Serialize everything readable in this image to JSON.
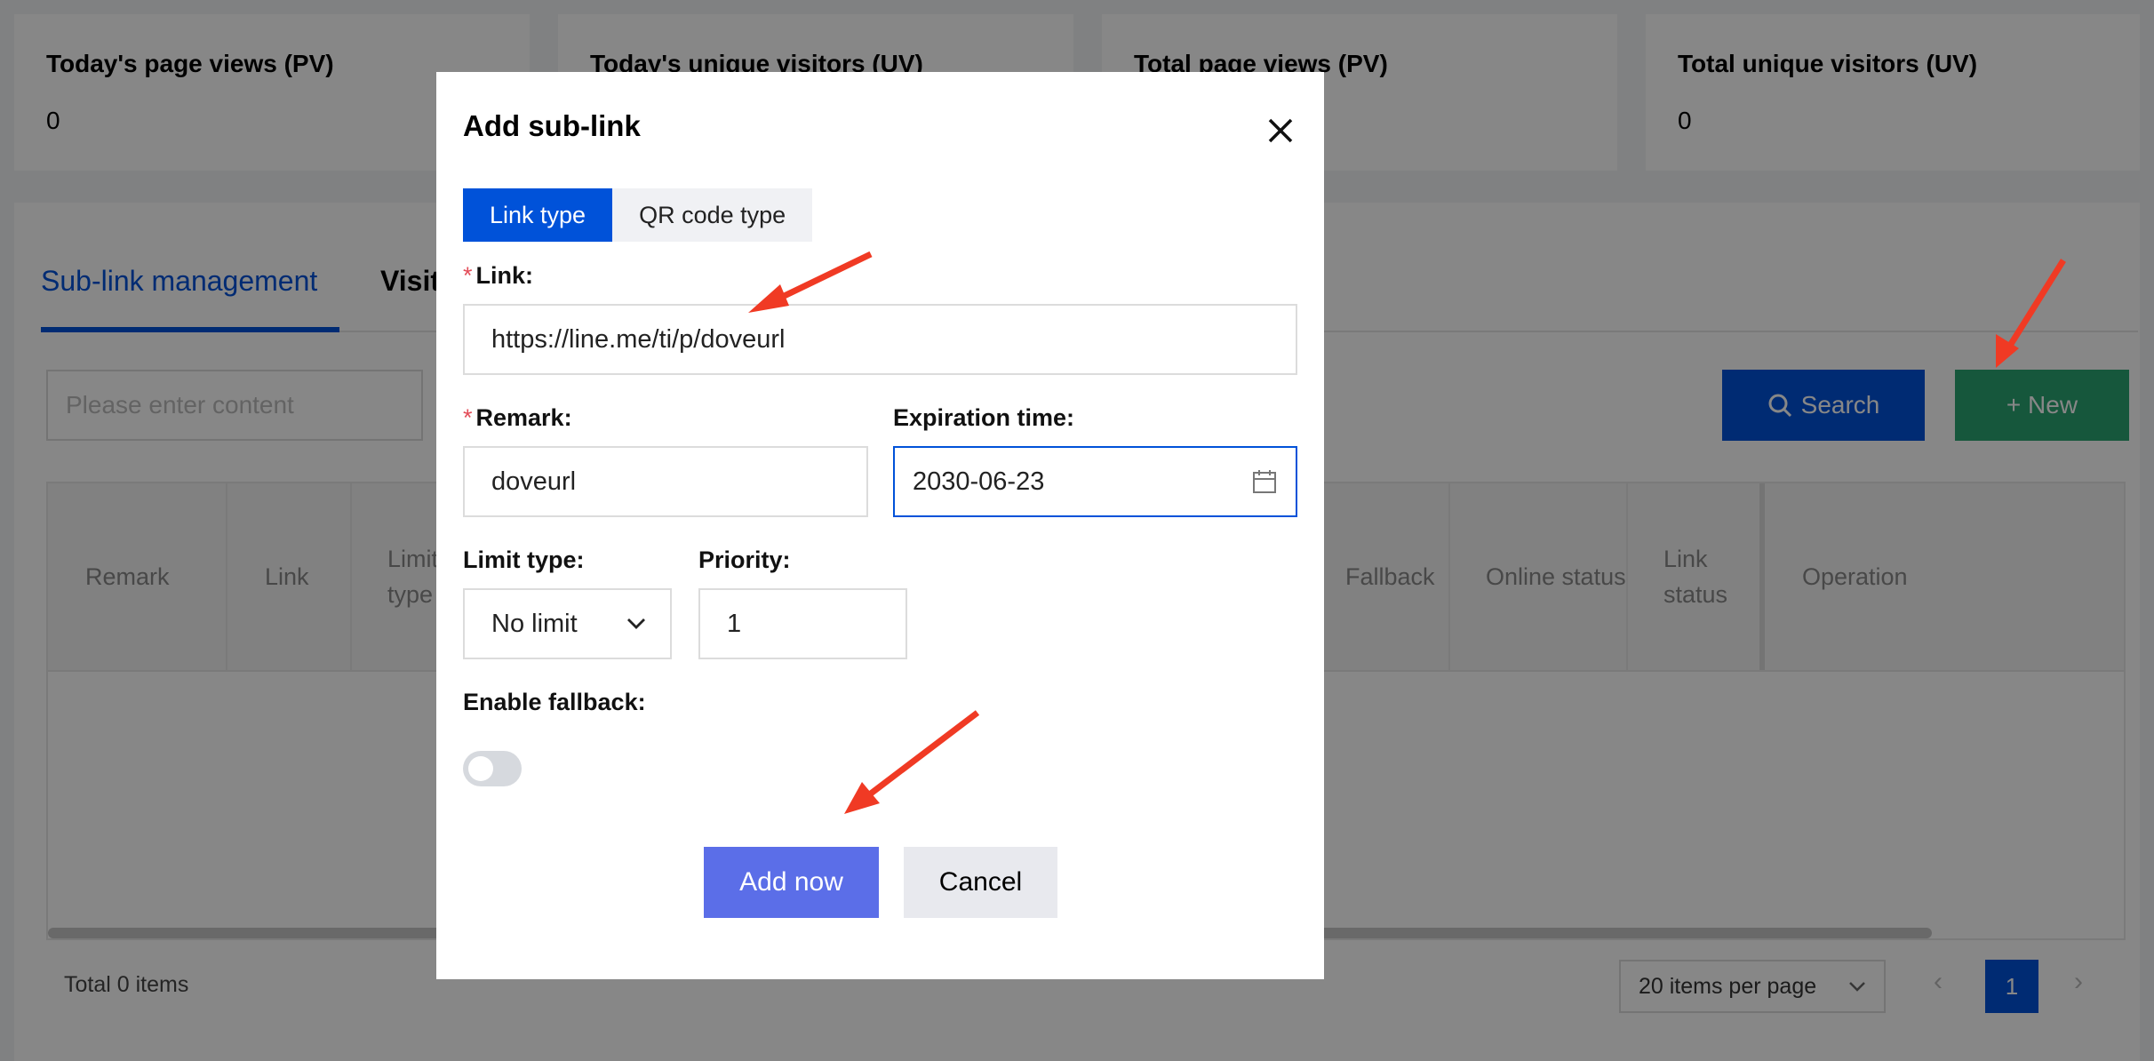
{
  "stats": [
    {
      "title": "Today's page views (PV)",
      "value": "0"
    },
    {
      "title": "Today's unique visitors (UV)",
      "value": ""
    },
    {
      "title": "Total page views (PV)",
      "value": ""
    },
    {
      "title": "Total unique visitors (UV)",
      "value": "0"
    }
  ],
  "tabs": {
    "active": "Sub-link management",
    "other": "Visit"
  },
  "toolbar": {
    "search_placeholder": "Please enter content",
    "search_label": "Search",
    "new_label": "+ New"
  },
  "table": {
    "columns": [
      "Remark",
      "Link",
      "Limit type",
      "Fallback",
      "Online status",
      "Link status",
      "Operation"
    ],
    "rows": []
  },
  "pagination": {
    "total": "Total 0 items",
    "page_size": "20 items per page",
    "current_page": "1"
  },
  "modal": {
    "title": "Add sub-link",
    "type_tabs": [
      "Link type",
      "QR code type"
    ],
    "link_label": "Link:",
    "link_value": "https://line.me/ti/p/doveurl",
    "remark_label": "Remark:",
    "remark_value": "doveurl",
    "expiration_label": "Expiration time:",
    "expiration_value": "2030-06-23",
    "limit_type_label": "Limit type:",
    "limit_type_value": "No limit",
    "priority_label": "Priority:",
    "priority_value": "1",
    "fallback_label": "Enable fallback:",
    "fallback_enabled": false,
    "add_label": "Add now",
    "cancel_label": "Cancel"
  },
  "colors": {
    "primary": "#0052d9",
    "success": "#2ba471",
    "annotation_arrow": "#f03a24",
    "add_button": "#5b6ee8"
  }
}
